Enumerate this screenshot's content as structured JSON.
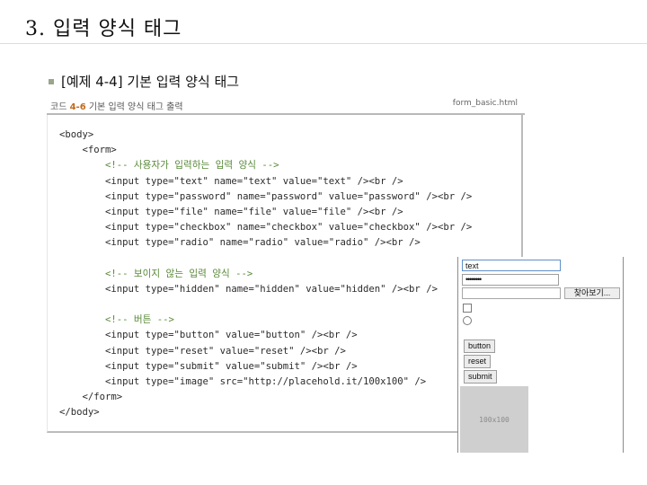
{
  "slide": {
    "title": "3. 입력 양식 태그",
    "bullet": "[예제 4-4] 기본 입력 양식 태그"
  },
  "code_header": {
    "label_prefix": "코드",
    "label_num": "4-6",
    "label_text": "기본 입력 양식 태그 출력",
    "filename": "form_basic.html"
  },
  "code_lines": [
    "<body>",
    "    <form>",
    "        <!-- 사용자가 입력하는 입력 양식 -->",
    "        <input type=\"text\" name=\"text\" value=\"text\" /><br />",
    "        <input type=\"password\" name=\"password\" value=\"password\" /><br />",
    "        <input type=\"file\" name=\"file\" value=\"file\" /><br />",
    "        <input type=\"checkbox\" name=\"checkbox\" value=\"checkbox\" /><br />",
    "        <input type=\"radio\" name=\"radio\" value=\"radio\" /><br />",
    "",
    "        <!-- 보이지 않는 입력 양식 -->",
    "        <input type=\"hidden\" name=\"hidden\" value=\"hidden\" /><br />",
    "",
    "        <!-- 버튼 -->",
    "        <input type=\"button\" value=\"button\" /><br />",
    "        <input type=\"reset\" value=\"reset\" /><br />",
    "        <input type=\"submit\" value=\"submit\" /><br />",
    "        <input type=\"image\" src=\"http://placehold.it/100x100\" />",
    "    </form>",
    "</body>"
  ],
  "preview": {
    "text_value": "text",
    "password_value": "••••••••",
    "file_button": "찾아보기...",
    "buttons": [
      "button",
      "reset",
      "submit"
    ],
    "image_label": "100x100"
  }
}
